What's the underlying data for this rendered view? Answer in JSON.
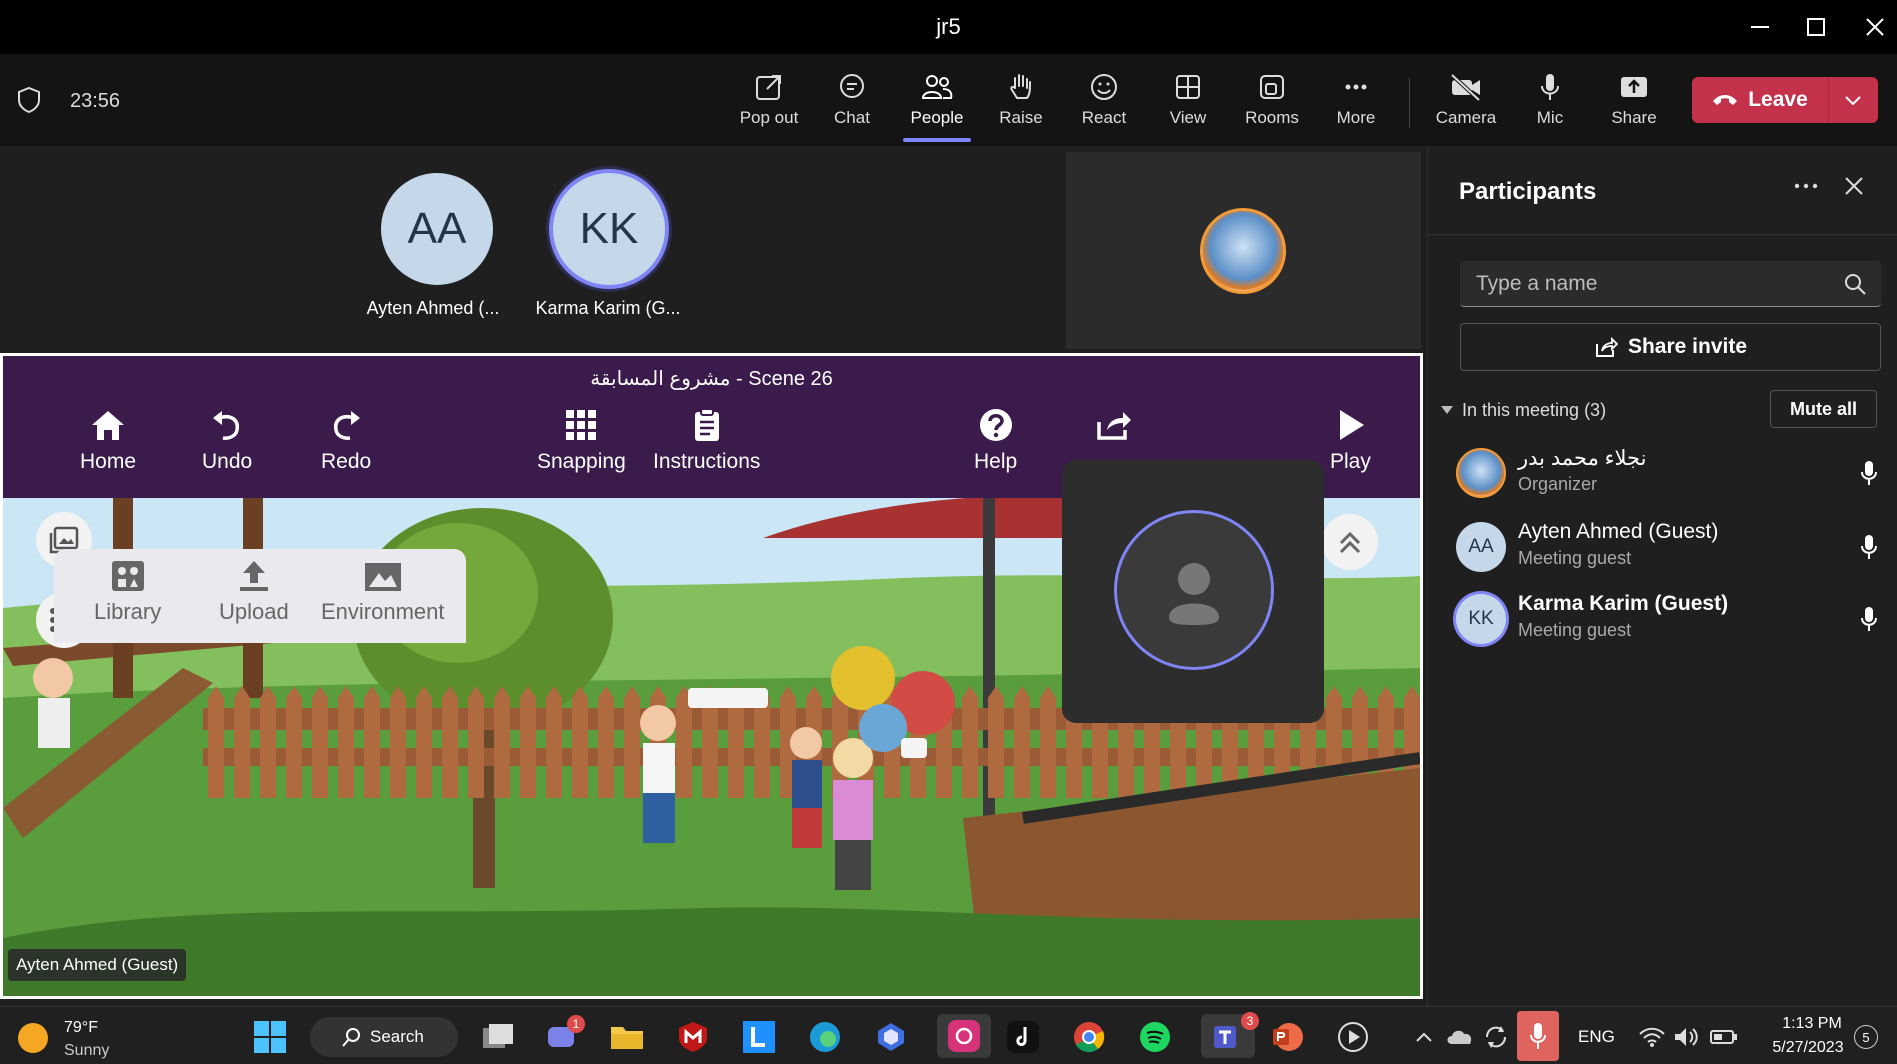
{
  "window": {
    "title": "jr5"
  },
  "meeting": {
    "timer": "23:56",
    "toolbar": [
      {
        "id": "popout",
        "label": "Pop out"
      },
      {
        "id": "chat",
        "label": "Chat"
      },
      {
        "id": "people",
        "label": "People"
      },
      {
        "id": "raise",
        "label": "Raise"
      },
      {
        "id": "react",
        "label": "React"
      },
      {
        "id": "view",
        "label": "View"
      },
      {
        "id": "rooms",
        "label": "Rooms"
      },
      {
        "id": "more",
        "label": "More"
      },
      {
        "id": "camera",
        "label": "Camera"
      },
      {
        "id": "mic",
        "label": "Mic"
      },
      {
        "id": "share",
        "label": "Share"
      }
    ],
    "leave_label": "Leave",
    "accent": "#7f85f5",
    "leave_color": "#c4314b"
  },
  "stage": {
    "tiles": [
      {
        "initials": "AA",
        "name": "Ayten Ahmed (..."
      },
      {
        "initials": "KK",
        "name": "Karma Karim (G..."
      }
    ],
    "name_tag": "Ayten Ahmed (Guest)"
  },
  "shared_app": {
    "title": "مشروع المسابقة - Scene 26",
    "toolbar": [
      {
        "id": "home",
        "label": "Home"
      },
      {
        "id": "undo",
        "label": "Undo"
      },
      {
        "id": "redo",
        "label": "Redo"
      },
      {
        "id": "snapping",
        "label": "Snapping"
      },
      {
        "id": "instructions",
        "label": "Instructions"
      },
      {
        "id": "help",
        "label": "Help"
      },
      {
        "id": "play",
        "label": "Play"
      }
    ],
    "bottom": [
      {
        "id": "library",
        "label": "Library"
      },
      {
        "id": "upload",
        "label": "Upload"
      },
      {
        "id": "environment",
        "label": "Environment"
      }
    ],
    "header_color": "#3b1b4c"
  },
  "participants": {
    "title": "Participants",
    "search_placeholder": "Type a name",
    "share_invite": "Share invite",
    "section_label": "In this meeting (3)",
    "mute_all": "Mute all",
    "list": [
      {
        "name": "نجلاء محمد بدر",
        "role": "Organizer",
        "initials": ""
      },
      {
        "name": "Ayten Ahmed (Guest)",
        "role": "Meeting guest",
        "initials": "AA"
      },
      {
        "name": "Karma Karim (Guest)",
        "role": "Meeting guest",
        "initials": "KK"
      }
    ]
  },
  "taskbar": {
    "weather_temp": "79°F",
    "weather_desc": "Sunny",
    "search_label": "Search",
    "lang": "ENG",
    "time": "1:13 PM",
    "date": "5/27/2023",
    "notif_count": "5",
    "chat_badge": "1",
    "teams_badge": "3"
  }
}
